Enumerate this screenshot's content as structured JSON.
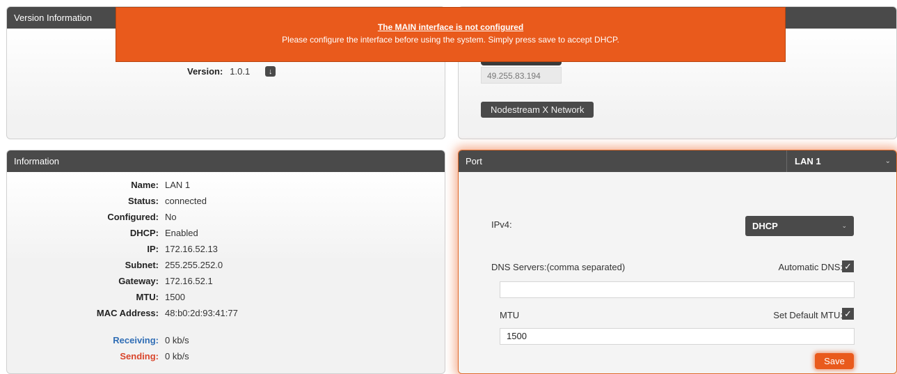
{
  "alert": {
    "title": "The MAIN interface is not configured",
    "message": "Please configure the interface before using the system. Simply press save to accept DHCP."
  },
  "version_panel": {
    "header": "Version Information",
    "version_label": "Version:",
    "version_value": "1.0.1",
    "download_icon": "download-icon"
  },
  "network_panel": {
    "ip_value": "49.255.83.194",
    "network_button": "Nodestream X Network"
  },
  "info_panel": {
    "header": "Information",
    "rows": [
      {
        "label": "Name:",
        "value": "LAN 1"
      },
      {
        "label": "Status:",
        "value": "connected"
      },
      {
        "label": "Configured:",
        "value": "No"
      },
      {
        "label": "DHCP:",
        "value": "Enabled"
      },
      {
        "label": "IP:",
        "value": "172.16.52.13"
      },
      {
        "label": "Subnet:",
        "value": "255.255.252.0"
      },
      {
        "label": "Gateway:",
        "value": "172.16.52.1"
      },
      {
        "label": "MTU:",
        "value": "1500"
      },
      {
        "label": "MAC Address:",
        "value": "48:b0:2d:93:41:77"
      }
    ],
    "receiving_label": "Receiving:",
    "receiving_value": "0 kb/s",
    "sending_label": "Sending:",
    "sending_value": "0 kb/s"
  },
  "port_panel": {
    "header": "Port",
    "selected_port": "LAN 1",
    "ipv4_label": "IPv4:",
    "ipv4_value": "DHCP",
    "dns_label": "DNS Servers:(comma separated)",
    "auto_dns_label": "Automatic DNS:",
    "auto_dns_checked": true,
    "dns_value": "",
    "mtu_label": "MTU",
    "set_default_mtu_label": "Set Default MTU:",
    "set_default_mtu_checked": true,
    "mtu_value": "1500",
    "save_label": "Save"
  },
  "colors": {
    "accent": "#e95a1c",
    "header_bg": "#4a4a4a",
    "receiving": "#2f6db5",
    "sending": "#d9452b"
  }
}
